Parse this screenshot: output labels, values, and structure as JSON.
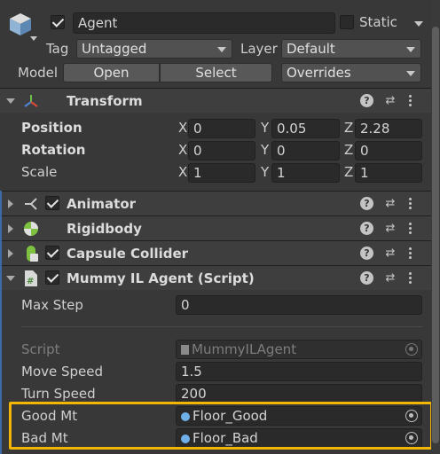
{
  "header": {
    "name": "Agent",
    "static_label": "Static",
    "tag_label": "Tag",
    "tag_value": "Untagged",
    "layer_label": "Layer",
    "layer_value": "Default",
    "model_label": "Model",
    "open_label": "Open",
    "select_label": "Select",
    "overrides_label": "Overrides"
  },
  "transform": {
    "title": "Transform",
    "position_label": "Position",
    "rotation_label": "Rotation",
    "scale_label": "Scale",
    "axis_x": "X",
    "axis_y": "Y",
    "axis_z": "Z",
    "position": {
      "x": "0",
      "y": "0.05",
      "z": "2.28"
    },
    "rotation": {
      "x": "0",
      "y": "0",
      "z": "0"
    },
    "scale": {
      "x": "1",
      "y": "1",
      "z": "1"
    }
  },
  "components": {
    "animator": "Animator",
    "rigidbody": "Rigidbody",
    "capsule": "Capsule Collider",
    "script": "Mummy IL Agent (Script)",
    "help_glyph": "?"
  },
  "script": {
    "max_step_label": "Max Step",
    "max_step_value": "0",
    "script_label": "Script",
    "script_value": "MummyILAgent",
    "move_speed_label": "Move Speed",
    "move_speed_value": "1.5",
    "turn_speed_label": "Turn Speed",
    "turn_speed_value": "200",
    "good_mt_label": "Good Mt",
    "good_mt_value": "Floor_Good",
    "bad_mt_label": "Bad Mt",
    "bad_mt_value": "Floor_Bad"
  },
  "colors": {
    "background": "#383838",
    "highlight": "#f2b705",
    "object_dot": "#6fb0e8"
  }
}
